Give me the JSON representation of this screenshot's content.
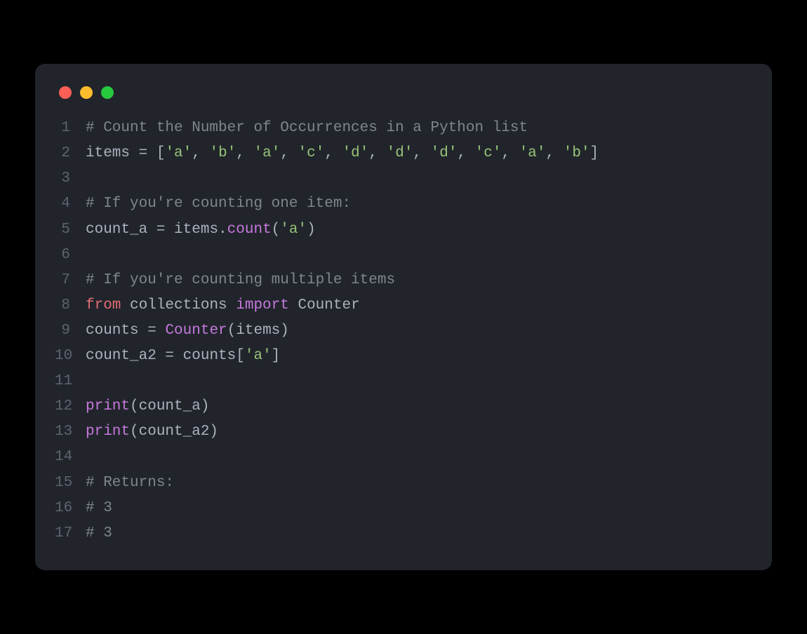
{
  "lines": [
    {
      "n": "1",
      "tokens": [
        {
          "t": "# Count the Number of Occurrences in a Python list",
          "cls": "c"
        }
      ]
    },
    {
      "n": "2",
      "tokens": [
        {
          "t": "items ",
          "cls": "d"
        },
        {
          "t": "=",
          "cls": "o"
        },
        {
          "t": " [",
          "cls": "d"
        },
        {
          "t": "'a'",
          "cls": "s"
        },
        {
          "t": ", ",
          "cls": "d"
        },
        {
          "t": "'b'",
          "cls": "s"
        },
        {
          "t": ", ",
          "cls": "d"
        },
        {
          "t": "'a'",
          "cls": "s"
        },
        {
          "t": ", ",
          "cls": "d"
        },
        {
          "t": "'c'",
          "cls": "s"
        },
        {
          "t": ", ",
          "cls": "d"
        },
        {
          "t": "'d'",
          "cls": "s"
        },
        {
          "t": ", ",
          "cls": "d"
        },
        {
          "t": "'d'",
          "cls": "s"
        },
        {
          "t": ", ",
          "cls": "d"
        },
        {
          "t": "'d'",
          "cls": "s"
        },
        {
          "t": ", ",
          "cls": "d"
        },
        {
          "t": "'c'",
          "cls": "s"
        },
        {
          "t": ", ",
          "cls": "d"
        },
        {
          "t": "'a'",
          "cls": "s"
        },
        {
          "t": ", ",
          "cls": "d"
        },
        {
          "t": "'b'",
          "cls": "s"
        },
        {
          "t": "]",
          "cls": "d"
        }
      ]
    },
    {
      "n": "3",
      "tokens": [
        {
          "t": "",
          "cls": "d"
        }
      ]
    },
    {
      "n": "4",
      "tokens": [
        {
          "t": "# If you're counting one item:",
          "cls": "c"
        }
      ]
    },
    {
      "n": "5",
      "tokens": [
        {
          "t": "count_a ",
          "cls": "d"
        },
        {
          "t": "=",
          "cls": "o"
        },
        {
          "t": " items.",
          "cls": "d"
        },
        {
          "t": "count",
          "cls": "fn"
        },
        {
          "t": "(",
          "cls": "d"
        },
        {
          "t": "'a'",
          "cls": "s"
        },
        {
          "t": ")",
          "cls": "d"
        }
      ]
    },
    {
      "n": "6",
      "tokens": [
        {
          "t": "",
          "cls": "d"
        }
      ]
    },
    {
      "n": "7",
      "tokens": [
        {
          "t": "# If you're counting multiple items",
          "cls": "c"
        }
      ]
    },
    {
      "n": "8",
      "tokens": [
        {
          "t": "from",
          "cls": "kr"
        },
        {
          "t": " collections ",
          "cls": "d"
        },
        {
          "t": "import",
          "cls": "k"
        },
        {
          "t": " Counter",
          "cls": "d"
        }
      ]
    },
    {
      "n": "9",
      "tokens": [
        {
          "t": "counts ",
          "cls": "d"
        },
        {
          "t": "=",
          "cls": "o"
        },
        {
          "t": " ",
          "cls": "d"
        },
        {
          "t": "Counter",
          "cls": "bi"
        },
        {
          "t": "(items)",
          "cls": "d"
        }
      ]
    },
    {
      "n": "10",
      "tokens": [
        {
          "t": "count_a2 ",
          "cls": "d"
        },
        {
          "t": "=",
          "cls": "o"
        },
        {
          "t": " counts[",
          "cls": "d"
        },
        {
          "t": "'a'",
          "cls": "s"
        },
        {
          "t": "]",
          "cls": "d"
        }
      ]
    },
    {
      "n": "11",
      "tokens": [
        {
          "t": "",
          "cls": "d"
        }
      ]
    },
    {
      "n": "12",
      "tokens": [
        {
          "t": "print",
          "cls": "bi"
        },
        {
          "t": "(count_a)",
          "cls": "d"
        }
      ]
    },
    {
      "n": "13",
      "tokens": [
        {
          "t": "print",
          "cls": "bi"
        },
        {
          "t": "(count_a2)",
          "cls": "d"
        }
      ]
    },
    {
      "n": "14",
      "tokens": [
        {
          "t": "",
          "cls": "d"
        }
      ]
    },
    {
      "n": "15",
      "tokens": [
        {
          "t": "# Returns:",
          "cls": "c"
        }
      ]
    },
    {
      "n": "16",
      "tokens": [
        {
          "t": "# 3",
          "cls": "c"
        }
      ]
    },
    {
      "n": "17",
      "tokens": [
        {
          "t": "# 3",
          "cls": "c"
        }
      ]
    }
  ]
}
